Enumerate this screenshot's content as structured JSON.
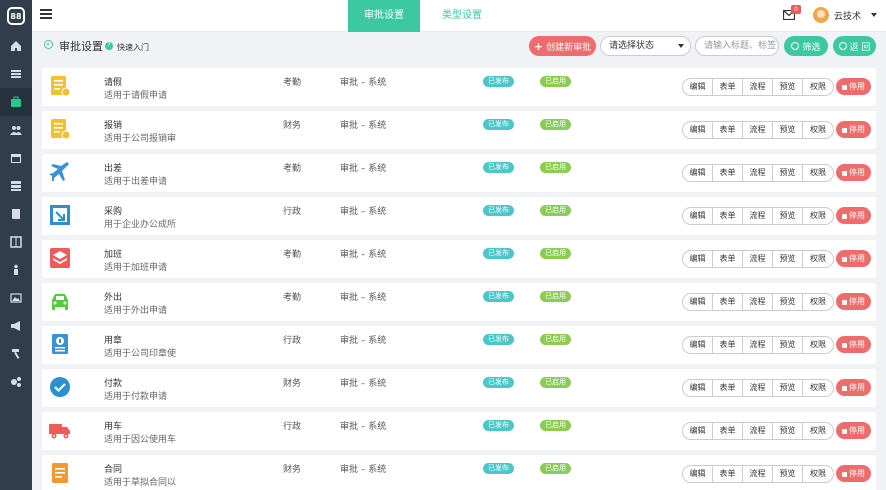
{
  "sidebar": {
    "logo": "88",
    "items": [
      {
        "icon": "home-icon"
      },
      {
        "icon": "list-icon"
      },
      {
        "icon": "briefcase-icon"
      },
      {
        "icon": "users-icon"
      },
      {
        "icon": "calendar-icon"
      },
      {
        "icon": "server-icon"
      },
      {
        "icon": "book-icon"
      },
      {
        "icon": "columns-icon"
      },
      {
        "icon": "person-icon"
      },
      {
        "icon": "image-icon"
      },
      {
        "icon": "megaphone-icon"
      },
      {
        "icon": "hammer-icon"
      },
      {
        "icon": "gears-icon"
      }
    ],
    "active_index": 2
  },
  "topbar": {
    "tabs": [
      {
        "label": "审批设置",
        "active": true
      },
      {
        "label": "类型设置",
        "active": false
      }
    ],
    "mail_count": "0",
    "user_name": "云技术"
  },
  "header": {
    "title": "审批设置",
    "quick_link": "快速入门",
    "create_label": "创建新审批",
    "status_select": "请选择状态",
    "search_placeholder": "请输入标题、标签",
    "filter_label": "筛选",
    "back_label": "返 回"
  },
  "actions": [
    "编辑",
    "表单",
    "流程",
    "预览",
    "权限"
  ],
  "stop_label": "停用",
  "rows": [
    {
      "title": "请假",
      "desc": "适用于请假申请",
      "type": "考勤",
      "sys": "审批 – 系统",
      "published": "已发布",
      "enabled": "已启用",
      "icon": "leave-doc-icon",
      "color": "#f3c12f"
    },
    {
      "title": "报销",
      "desc": "适用于公司报销审",
      "type": "财务",
      "sys": "审批 – 系统",
      "published": "已发布",
      "enabled": "已启用",
      "icon": "expense-doc-icon",
      "color": "#f3c12f"
    },
    {
      "title": "出差",
      "desc": "适用于出差申请",
      "type": "考勤",
      "sys": "审批 – 系统",
      "published": "已发布",
      "enabled": "已启用",
      "icon": "airplane-icon",
      "color": "#3d92d6"
    },
    {
      "title": "采购",
      "desc": "用于企业办公成所",
      "type": "行政",
      "sys": "审批 – 系统",
      "published": "已发布",
      "enabled": "已启用",
      "icon": "purchase-icon",
      "color": "#2e8fd0"
    },
    {
      "title": "加班",
      "desc": "适用于加班申请",
      "type": "考勤",
      "sys": "审批 – 系统",
      "published": "已发布",
      "enabled": "已启用",
      "icon": "layers-icon",
      "color": "#ef5a5a"
    },
    {
      "title": "外出",
      "desc": "适用于外出申请",
      "type": "考勤",
      "sys": "审批 – 系统",
      "published": "已发布",
      "enabled": "已启用",
      "icon": "car-icon",
      "color": "#58c840"
    },
    {
      "title": "用章",
      "desc": "适用于公司印章使",
      "type": "行政",
      "sys": "审批 – 系统",
      "published": "已发布",
      "enabled": "已启用",
      "icon": "seal-icon",
      "color": "#3d92d6"
    },
    {
      "title": "付款",
      "desc": "适用于付款申请",
      "type": "财务",
      "sys": "审批 – 系统",
      "published": "已发布",
      "enabled": "已启用",
      "icon": "check-circle-icon",
      "color": "#2e8fd0"
    },
    {
      "title": "用车",
      "desc": "适用于因公使用车",
      "type": "行政",
      "sys": "审批 – 系统",
      "published": "已发布",
      "enabled": "已启用",
      "icon": "truck-icon",
      "color": "#ef5a5a"
    },
    {
      "title": "合同",
      "desc": "适用于草拟合同以",
      "type": "财务",
      "sys": "审批 – 系统",
      "published": "已发布",
      "enabled": "已启用",
      "icon": "contract-icon",
      "color": "#f39a2f"
    }
  ]
}
